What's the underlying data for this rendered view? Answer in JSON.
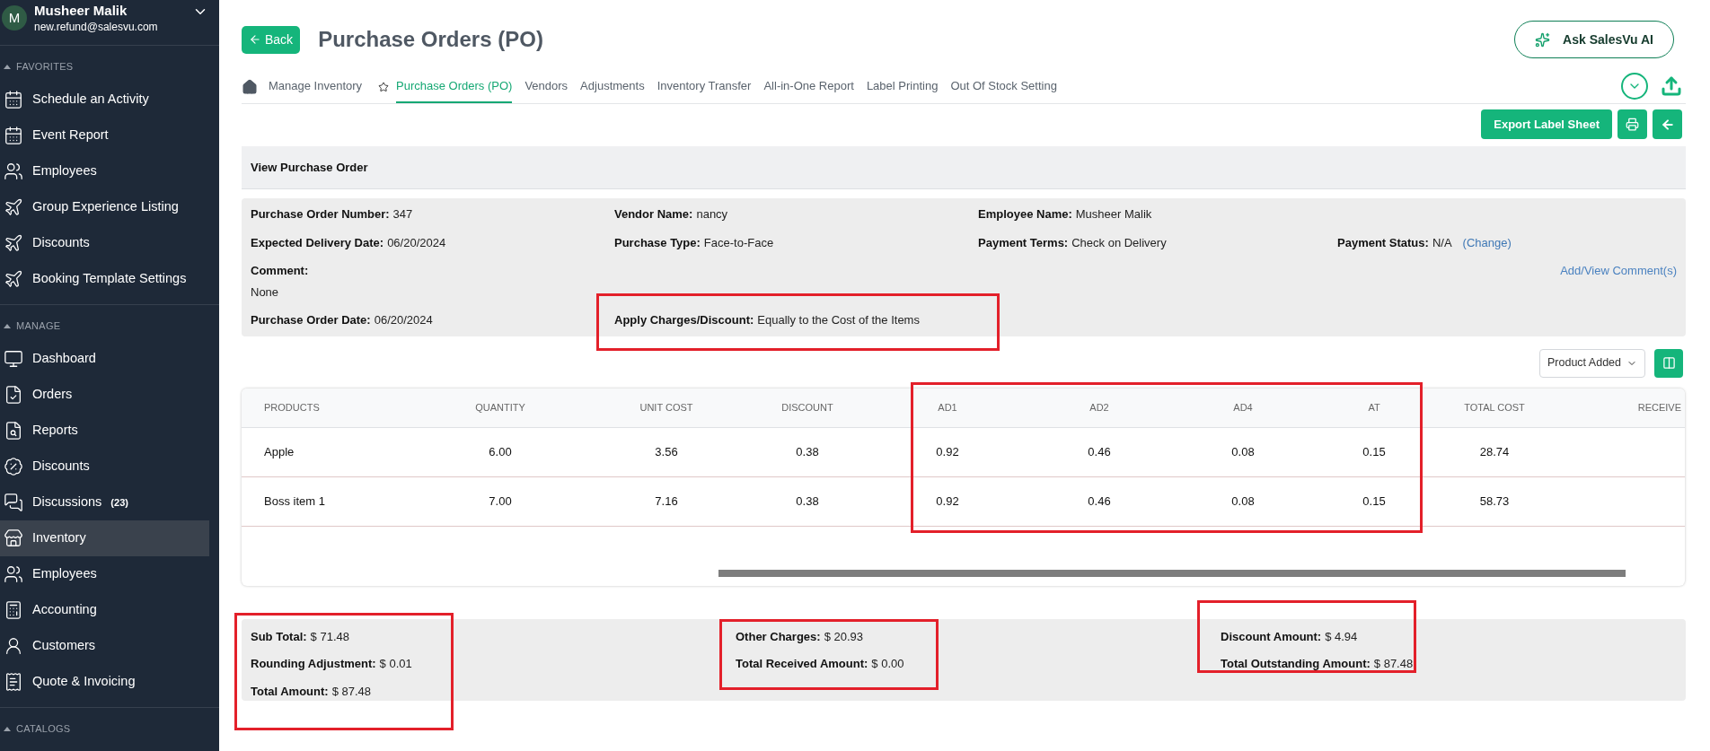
{
  "user": {
    "initial": "M",
    "name": "Musheer Malik",
    "email": "new.refund@salesvu.com"
  },
  "sidebar": {
    "sections": [
      {
        "title": "FAVORITES",
        "expanded": true,
        "items": [
          {
            "label": "Schedule an Activity",
            "selected": false
          },
          {
            "label": "Event Report",
            "selected": false
          },
          {
            "label": "Employees",
            "selected": false
          },
          {
            "label": "Group Experience Listing",
            "selected": false
          },
          {
            "label": "Discounts",
            "selected": false
          },
          {
            "label": "Booking Template Settings",
            "selected": false
          }
        ]
      },
      {
        "title": "MANAGE",
        "expanded": true,
        "items": [
          {
            "label": "Dashboard",
            "selected": false
          },
          {
            "label": "Orders",
            "selected": false
          },
          {
            "label": "Reports",
            "selected": false
          },
          {
            "label": "Discounts",
            "selected": false
          },
          {
            "label": "Discussions",
            "count": "(23)",
            "selected": false
          },
          {
            "label": "Inventory",
            "selected": true
          },
          {
            "label": "Employees",
            "selected": false
          },
          {
            "label": "Accounting",
            "selected": false
          },
          {
            "label": "Customers",
            "selected": false
          },
          {
            "label": "Quote & Invoicing",
            "selected": false
          }
        ]
      },
      {
        "title": "CATALOGS",
        "expanded": true
      }
    ]
  },
  "header": {
    "back": "Back",
    "title": "Purchase Orders (PO)",
    "ai_button": "Ask SalesVu AI"
  },
  "tabs": [
    {
      "label": "Manage Inventory",
      "selected": false
    },
    {
      "label": "Purchase Orders (PO)",
      "selected": true
    },
    {
      "label": "Vendors",
      "selected": false
    },
    {
      "label": "Adjustments",
      "selected": false
    },
    {
      "label": "Inventory Transfer",
      "selected": false
    },
    {
      "label": "All-in-One Report",
      "selected": false
    },
    {
      "label": "Label Printing",
      "selected": false
    },
    {
      "label": "Out Of Stock Setting",
      "selected": false
    }
  ],
  "actions": {
    "export": "Export Label Sheet"
  },
  "section_title": "View Purchase Order",
  "info_rows": [
    [
      {
        "label": "Purchase Order Number:",
        "value": "347",
        "highlighted": false
      },
      {
        "label": "Vendor Name:",
        "value": "nancy",
        "highlighted": false
      },
      {
        "label": "Employee Name:",
        "value": "Musheer Malik",
        "highlighted": false
      },
      null
    ],
    [
      {
        "label": "Expected Delivery Date:",
        "value": "06/20/2024",
        "highlighted": false
      },
      {
        "label": "Purchase Type:",
        "value": "Face-to-Face",
        "highlighted": false
      },
      {
        "label": "Payment Terms:",
        "value": "Check on Delivery",
        "highlighted": false
      },
      {
        "label": "Payment Status:",
        "value": "N/A",
        "link": "(Change)",
        "highlighted": false
      }
    ],
    [
      {
        "label": "Comment:",
        "value": "None",
        "stacked": true,
        "highlighted": false
      },
      null,
      null,
      {
        "link": "Add/View Comment(s)",
        "highlighted": false
      }
    ],
    [
      {
        "label": "Purchase Order Date:",
        "value": "06/20/2024",
        "highlighted": false
      },
      {
        "label": "Apply Charges/Discount:",
        "value": "Equally to the Cost of the Items",
        "highlighted": true
      },
      null,
      null
    ]
  ],
  "sort_select": {
    "value": "Product Added"
  },
  "table": {
    "columns": [
      {
        "label": "PRODUCTS",
        "highlighted": false
      },
      {
        "label": "QUANTITY",
        "highlighted": false
      },
      {
        "label": "UNIT COST",
        "highlighted": false
      },
      {
        "label": "DISCOUNT",
        "highlighted": false
      },
      {
        "label": "AD1",
        "highlighted": true
      },
      {
        "label": "AD2",
        "highlighted": true
      },
      {
        "label": "AD4",
        "highlighted": true
      },
      {
        "label": "AT",
        "highlighted": true
      },
      {
        "label": "TOTAL COST",
        "highlighted": false
      },
      {
        "label": "RECEIVE",
        "highlighted": false
      }
    ],
    "rows": [
      [
        "Apple",
        "6.00",
        "3.56",
        "0.38",
        "0.92",
        "0.46",
        "0.08",
        "0.15",
        "28.74",
        ""
      ],
      [
        "Boss item 1",
        "7.00",
        "7.16",
        "0.38",
        "0.92",
        "0.46",
        "0.08",
        "0.15",
        "58.73",
        ""
      ]
    ]
  },
  "totals": [
    {
      "highlighted": true,
      "items": [
        {
          "label": "Sub Total:",
          "value": "$ 71.48"
        },
        {
          "label": "Rounding Adjustment:",
          "value": "$ 0.01"
        },
        {
          "label": "Total Amount:",
          "value": "$ 87.48"
        }
      ]
    },
    {
      "highlighted": true,
      "items": [
        {
          "label": "Other Charges:",
          "value": "$ 20.93"
        },
        {
          "label": "Total Received Amount:",
          "value": "$ 0.00"
        }
      ]
    },
    {
      "highlighted": true,
      "items": [
        {
          "label": "Discount Amount:",
          "value": "$ 4.94"
        },
        {
          "label": "Total Outstanding Amount:",
          "value": "$ 87.48"
        }
      ]
    }
  ]
}
